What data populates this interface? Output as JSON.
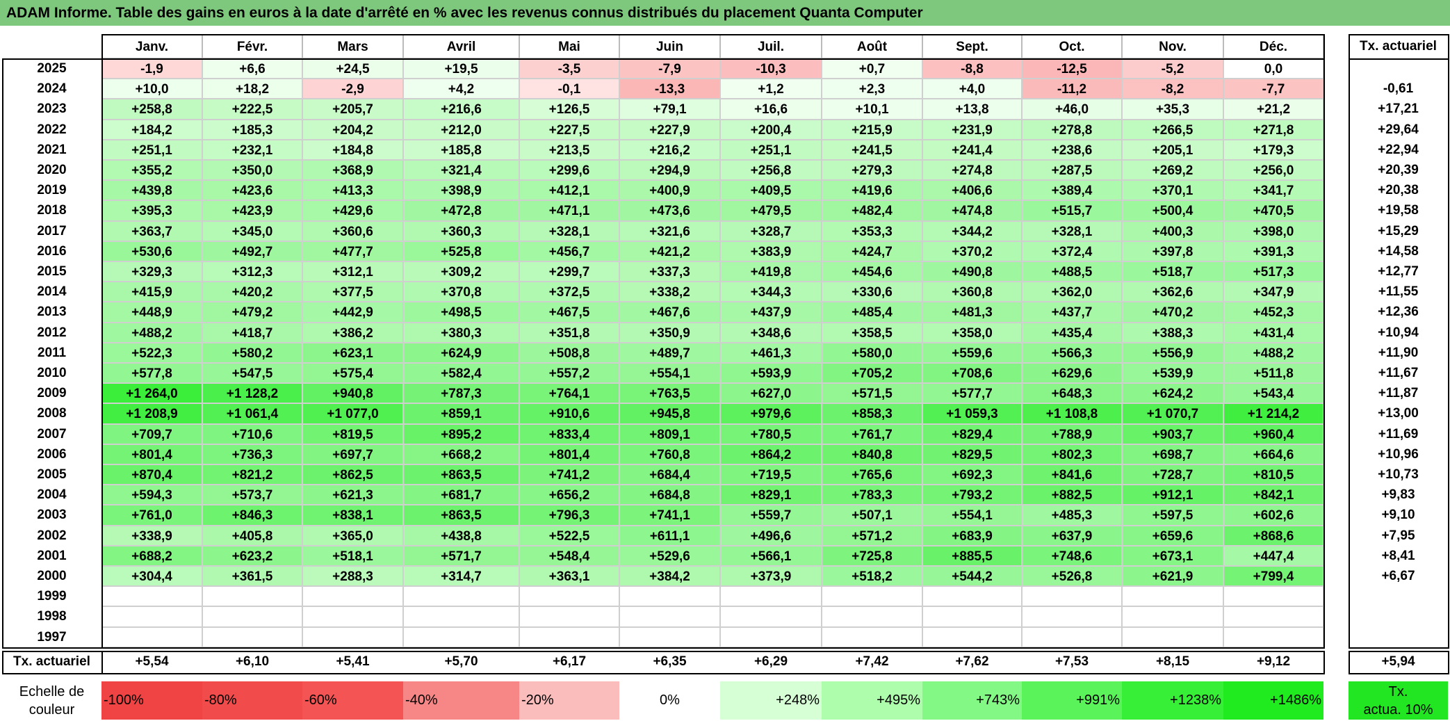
{
  "title": "ADAM Informe. Table des gains en euros à la date d'arrêté en % avec les revenus connus distribués du placement Quanta Computer",
  "months": [
    "Janv.",
    "Févr.",
    "Mars",
    "Avril",
    "Mai",
    "Juin",
    "Juil.",
    "Août",
    "Sept.",
    "Oct.",
    "Nov.",
    "Déc."
  ],
  "actuarial_header": "Tx. actuariel",
  "rows": [
    {
      "year": "2025",
      "values": [
        "-1,9",
        "+6,6",
        "+24,5",
        "+19,5",
        "-3,5",
        "-7,9",
        "-10,3",
        "+0,7",
        "-8,8",
        "-12,5",
        "-5,2",
        "0,0"
      ],
      "rate": ""
    },
    {
      "year": "2024",
      "values": [
        "+10,0",
        "+18,2",
        "-2,9",
        "+4,2",
        "-0,1",
        "-13,3",
        "+1,2",
        "+2,3",
        "+4,0",
        "-11,2",
        "-8,2",
        "-7,7"
      ],
      "rate": "-0,61"
    },
    {
      "year": "2023",
      "values": [
        "+258,8",
        "+222,5",
        "+205,7",
        "+216,6",
        "+126,5",
        "+79,1",
        "+16,6",
        "+10,1",
        "+13,8",
        "+46,0",
        "+35,3",
        "+21,2"
      ],
      "rate": "+17,21"
    },
    {
      "year": "2022",
      "values": [
        "+184,2",
        "+185,3",
        "+204,2",
        "+212,0",
        "+227,5",
        "+227,9",
        "+200,4",
        "+215,9",
        "+231,9",
        "+278,8",
        "+266,5",
        "+271,8"
      ],
      "rate": "+29,64"
    },
    {
      "year": "2021",
      "values": [
        "+251,1",
        "+232,1",
        "+184,8",
        "+185,8",
        "+213,5",
        "+216,2",
        "+251,1",
        "+241,5",
        "+241,4",
        "+238,6",
        "+205,1",
        "+179,3"
      ],
      "rate": "+22,94"
    },
    {
      "year": "2020",
      "values": [
        "+355,2",
        "+350,0",
        "+368,9",
        "+321,4",
        "+299,6",
        "+294,9",
        "+256,8",
        "+279,3",
        "+274,8",
        "+287,5",
        "+269,2",
        "+256,0"
      ],
      "rate": "+20,39"
    },
    {
      "year": "2019",
      "values": [
        "+439,8",
        "+423,6",
        "+413,3",
        "+398,9",
        "+412,1",
        "+400,9",
        "+409,5",
        "+419,6",
        "+406,6",
        "+389,4",
        "+370,1",
        "+341,7"
      ],
      "rate": "+20,38"
    },
    {
      "year": "2018",
      "values": [
        "+395,3",
        "+423,9",
        "+429,6",
        "+472,8",
        "+471,1",
        "+473,6",
        "+479,5",
        "+482,4",
        "+474,8",
        "+515,7",
        "+500,4",
        "+470,5"
      ],
      "rate": "+19,58"
    },
    {
      "year": "2017",
      "values": [
        "+363,7",
        "+345,0",
        "+360,6",
        "+360,3",
        "+328,1",
        "+321,6",
        "+328,7",
        "+353,3",
        "+344,2",
        "+328,1",
        "+400,3",
        "+398,0"
      ],
      "rate": "+15,29"
    },
    {
      "year": "2016",
      "values": [
        "+530,6",
        "+492,7",
        "+477,7",
        "+525,8",
        "+456,7",
        "+421,2",
        "+383,9",
        "+424,7",
        "+370,2",
        "+372,4",
        "+397,8",
        "+391,3"
      ],
      "rate": "+14,58"
    },
    {
      "year": "2015",
      "values": [
        "+329,3",
        "+312,3",
        "+312,1",
        "+309,2",
        "+299,7",
        "+337,3",
        "+419,8",
        "+454,6",
        "+490,8",
        "+488,5",
        "+518,7",
        "+517,3"
      ],
      "rate": "+12,77"
    },
    {
      "year": "2014",
      "values": [
        "+415,9",
        "+420,2",
        "+377,5",
        "+370,8",
        "+372,5",
        "+338,2",
        "+344,3",
        "+330,6",
        "+360,8",
        "+362,0",
        "+362,6",
        "+347,9"
      ],
      "rate": "+11,55"
    },
    {
      "year": "2013",
      "values": [
        "+448,9",
        "+479,2",
        "+442,9",
        "+498,5",
        "+467,5",
        "+467,6",
        "+437,9",
        "+485,4",
        "+481,3",
        "+437,7",
        "+470,2",
        "+452,3"
      ],
      "rate": "+12,36"
    },
    {
      "year": "2012",
      "values": [
        "+488,2",
        "+418,7",
        "+386,2",
        "+380,3",
        "+351,8",
        "+350,9",
        "+348,6",
        "+358,5",
        "+358,0",
        "+435,4",
        "+388,3",
        "+431,4"
      ],
      "rate": "+10,94"
    },
    {
      "year": "2011",
      "values": [
        "+522,3",
        "+580,2",
        "+623,1",
        "+624,9",
        "+508,8",
        "+489,7",
        "+461,3",
        "+580,0",
        "+559,6",
        "+566,3",
        "+556,9",
        "+488,2"
      ],
      "rate": "+11,90"
    },
    {
      "year": "2010",
      "values": [
        "+577,8",
        "+547,5",
        "+575,4",
        "+582,4",
        "+557,2",
        "+554,1",
        "+593,9",
        "+705,2",
        "+708,6",
        "+629,6",
        "+539,9",
        "+511,8"
      ],
      "rate": "+11,67"
    },
    {
      "year": "2009",
      "values": [
        "+1 264,0",
        "+1 128,2",
        "+940,8",
        "+787,3",
        "+764,1",
        "+763,5",
        "+627,0",
        "+571,5",
        "+577,7",
        "+648,3",
        "+624,2",
        "+543,4"
      ],
      "rate": "+11,87"
    },
    {
      "year": "2008",
      "values": [
        "+1 208,9",
        "+1 061,4",
        "+1 077,0",
        "+859,1",
        "+910,6",
        "+945,8",
        "+979,6",
        "+858,3",
        "+1 059,3",
        "+1 108,8",
        "+1 070,7",
        "+1 214,2"
      ],
      "rate": "+13,00"
    },
    {
      "year": "2007",
      "values": [
        "+709,7",
        "+710,6",
        "+819,5",
        "+895,2",
        "+833,4",
        "+809,1",
        "+780,5",
        "+761,7",
        "+829,4",
        "+788,9",
        "+903,7",
        "+960,4"
      ],
      "rate": "+11,69"
    },
    {
      "year": "2006",
      "values": [
        "+801,4",
        "+736,3",
        "+697,7",
        "+668,2",
        "+801,4",
        "+760,8",
        "+864,2",
        "+840,8",
        "+829,5",
        "+802,3",
        "+698,7",
        "+664,6"
      ],
      "rate": "+10,96"
    },
    {
      "year": "2005",
      "values": [
        "+870,4",
        "+821,2",
        "+862,5",
        "+863,5",
        "+741,2",
        "+684,4",
        "+719,5",
        "+765,6",
        "+692,3",
        "+841,6",
        "+728,7",
        "+810,5"
      ],
      "rate": "+10,73"
    },
    {
      "year": "2004",
      "values": [
        "+594,3",
        "+573,7",
        "+621,3",
        "+681,7",
        "+656,2",
        "+684,8",
        "+829,1",
        "+783,3",
        "+793,2",
        "+882,5",
        "+912,1",
        "+842,1"
      ],
      "rate": "+9,83"
    },
    {
      "year": "2003",
      "values": [
        "+761,0",
        "+846,3",
        "+838,1",
        "+863,5",
        "+796,3",
        "+741,1",
        "+559,7",
        "+507,1",
        "+554,1",
        "+485,3",
        "+597,5",
        "+602,6"
      ],
      "rate": "+9,10"
    },
    {
      "year": "2002",
      "values": [
        "+338,9",
        "+405,8",
        "+365,0",
        "+438,8",
        "+522,5",
        "+611,1",
        "+496,6",
        "+571,2",
        "+683,9",
        "+637,9",
        "+659,6",
        "+868,6"
      ],
      "rate": "+7,95"
    },
    {
      "year": "2001",
      "values": [
        "+688,2",
        "+623,2",
        "+518,1",
        "+571,7",
        "+548,4",
        "+529,6",
        "+566,1",
        "+725,8",
        "+885,5",
        "+748,6",
        "+673,1",
        "+447,4"
      ],
      "rate": "+8,41"
    },
    {
      "year": "2000",
      "values": [
        "+304,4",
        "+361,5",
        "+288,3",
        "+314,7",
        "+363,1",
        "+384,2",
        "+373,9",
        "+518,2",
        "+544,2",
        "+526,8",
        "+621,9",
        "+799,4"
      ],
      "rate": "+6,67"
    },
    {
      "year": "1999",
      "values": [
        "",
        "",
        "",
        "",
        "",
        "",
        "",
        "",
        "",
        "",
        "",
        ""
      ],
      "rate": ""
    },
    {
      "year": "1998",
      "values": [
        "",
        "",
        "",
        "",
        "",
        "",
        "",
        "",
        "",
        "",
        "",
        ""
      ],
      "rate": ""
    },
    {
      "year": "1997",
      "values": [
        "",
        "",
        "",
        "",
        "",
        "",
        "",
        "",
        "",
        "",
        "",
        ""
      ],
      "rate": ""
    }
  ],
  "footer": {
    "label": "Tx. actuariel",
    "values": [
      "+5,54",
      "+6,10",
      "+5,41",
      "+5,70",
      "+6,17",
      "+6,35",
      "+6,29",
      "+7,42",
      "+7,62",
      "+7,53",
      "+8,15",
      "+9,12"
    ],
    "total": "+5,94"
  },
  "scale": {
    "label_line1": "Echelle de",
    "label_line2": "couleur",
    "entries": [
      {
        "text": "-100%",
        "color": "#f04444"
      },
      {
        "text": "-80%",
        "color": "#f24b4b"
      },
      {
        "text": "-60%",
        "color": "#f45454"
      },
      {
        "text": "-40%",
        "color": "#f78686"
      },
      {
        "text": "-20%",
        "color": "#fbbcbc"
      },
      {
        "text": "0%",
        "color": "#ffffff"
      },
      {
        "text": "+248%",
        "color": "#d6ffd6"
      },
      {
        "text": "+495%",
        "color": "#adfdad"
      },
      {
        "text": "+743%",
        "color": "#84f884"
      },
      {
        "text": "+991%",
        "color": "#5af45a"
      },
      {
        "text": "+1238%",
        "color": "#38ef38"
      },
      {
        "text": "+1486%",
        "color": "#1feb1f"
      }
    ],
    "target_line1": "Tx.",
    "target_line2": "actua. 10%",
    "target_color": "#22e622"
  },
  "colors": {
    "title_bg": "#7ec87e",
    "negative": "#f04444",
    "positive": "#1feb1f"
  }
}
